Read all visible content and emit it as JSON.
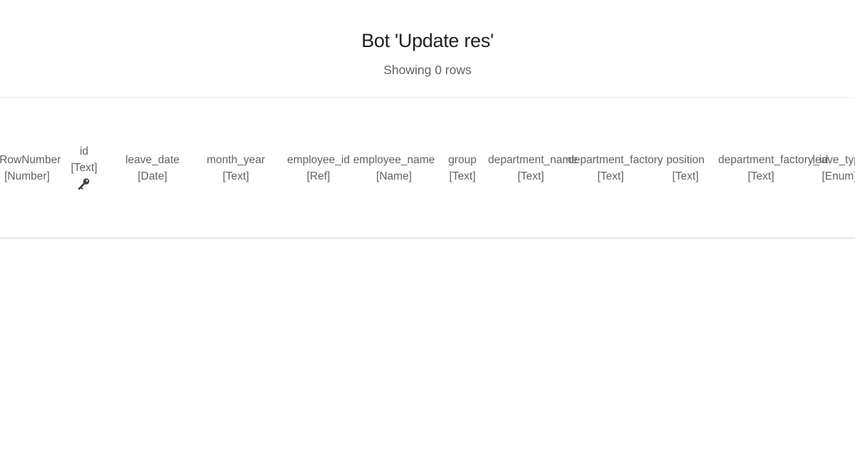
{
  "header": {
    "title": "Bot 'Update res'",
    "subtitle": "Showing 0 rows"
  },
  "columns": [
    {
      "name": "_RowNumber",
      "type": "[Number]"
    },
    {
      "name": "id",
      "type": "[Text]",
      "key": true,
      "icon": "key-icon"
    },
    {
      "name": "leave_date",
      "type": "[Date]"
    },
    {
      "name": "month_year",
      "type": "[Text]"
    },
    {
      "name": "employee_id",
      "type": "[Ref]"
    },
    {
      "name": "employee_name",
      "type": "[Name]"
    },
    {
      "name": "group",
      "type": "[Text]"
    },
    {
      "name": "department_name",
      "type": "[Text]"
    },
    {
      "name": "department_factory",
      "type": "[Text]"
    },
    {
      "name": "position",
      "type": "[Text]"
    },
    {
      "name": "department_factory_id",
      "type": "[Text]"
    },
    {
      "name": "leave_type",
      "type": "[Enum]"
    }
  ]
}
